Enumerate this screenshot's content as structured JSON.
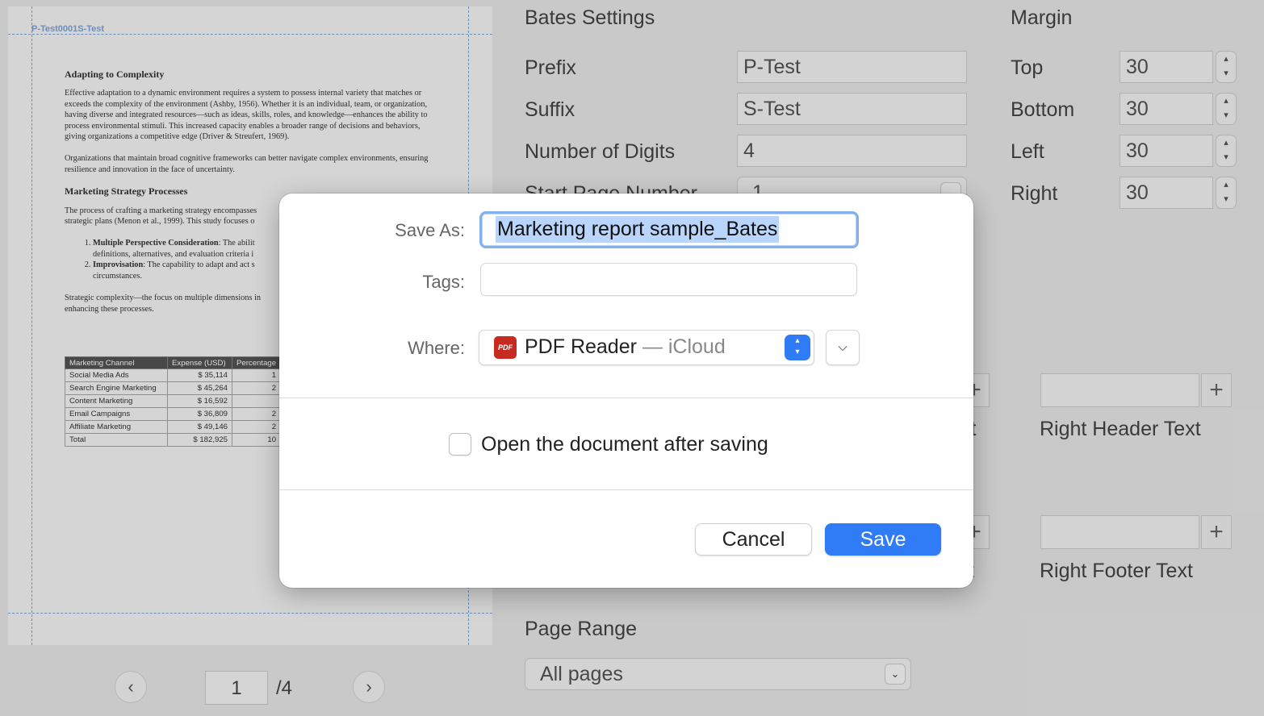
{
  "preview": {
    "bates_label": "P-Test0001S-Test",
    "heading1": "Adapting to Complexity",
    "para1": "Effective adaptation to a dynamic environment requires a system to possess internal variety that matches or exceeds the complexity of the environment (Ashby, 1956). Whether it is an individual, team, or organization, having diverse and integrated resources—such as ideas, skills, roles, and knowledge—enhances the ability to process environmental stimuli. This increased capacity enables a broader range of decisions and behaviors, giving organizations a competitive edge (Driver & Streufert, 1969).",
    "para2": "Organizations that maintain broad cognitive frameworks can better navigate complex environments, ensuring resilience and innovation in the face of uncertainty.",
    "heading2": "Marketing Strategy Processes",
    "para3": "The process of crafting a marketing strategy encompasses strategic plans (Menon et al., 1999). This study focuses o",
    "list": [
      {
        "bold": "Multiple Perspective Consideration",
        "text": ": The abilit definitions, alternatives, and evaluation criteria i"
      },
      {
        "bold": "Improvisation",
        "text": ": The capability to adapt and act s circumstances."
      }
    ],
    "para4": "Strategic complexity—the focus on multiple dimensions in enhancing these processes.",
    "table": {
      "headers": [
        "Marketing Channel",
        "Expense (USD)",
        "Percentage"
      ],
      "rows": [
        [
          "Social Media Ads",
          "$ 35,114",
          "1"
        ],
        [
          "Search Engine Marketing",
          "$ 45,264",
          "2"
        ],
        [
          "Content Marketing",
          "$ 16,592",
          ""
        ],
        [
          "Email Campaigns",
          "$ 36,809",
          "2"
        ],
        [
          "Affiliate Marketing",
          "$ 49,146",
          "2"
        ],
        [
          "Total",
          "$ 182,925",
          "10"
        ]
      ]
    }
  },
  "pager": {
    "prev_icon": "chevron-left-icon",
    "next_icon": "chevron-right-icon",
    "current_page": "1",
    "total": "/4"
  },
  "bates": {
    "title": "Bates Settings",
    "prefix_label": "Prefix",
    "prefix_value": "P-Test",
    "suffix_label": "Suffix",
    "suffix_value": "S-Test",
    "digits_label": "Number of Digits",
    "digits_value": "4",
    "start_label": "Start Page Number",
    "start_value": "1"
  },
  "margin": {
    "title": "Margin",
    "top_label": "Top",
    "top_value": "30",
    "bottom_label": "Bottom",
    "bottom_value": "30",
    "left_label": "Left",
    "left_value": "30",
    "right_label": "Right",
    "right_value": "30"
  },
  "header_footer": {
    "header_partial_label": "xt",
    "right_header_label": "Right Header Text",
    "footer_partial_label": "t",
    "right_footer_label": "Right Footer Text"
  },
  "page_range": {
    "title": "Page Range",
    "value": "All pages"
  },
  "dialog": {
    "save_as_label": "Save As:",
    "save_as_value": "Marketing report sample_Bates",
    "tags_label": "Tags:",
    "where_label": "Where:",
    "where_icon_text": "PDF",
    "where_location": "PDF Reader",
    "where_sep": " — ",
    "where_service": "iCloud",
    "open_after_label": "Open the document after saving",
    "cancel_label": "Cancel",
    "save_label": "Save"
  },
  "colors": {
    "accent": "#2f7cf6",
    "selection": "#b9d5fb",
    "pdf_icon": "#c72a20",
    "guide": "#7fa7d8"
  }
}
